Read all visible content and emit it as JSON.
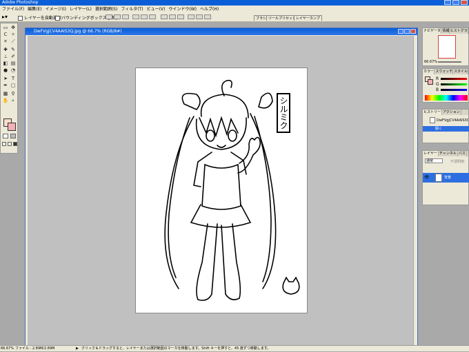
{
  "app": {
    "title": "Adobe Photoshop"
  },
  "menu": [
    "ファイル(F)",
    "編集(E)",
    "イメージ(I)",
    "レイヤー(L)",
    "選択範囲(S)",
    "フィルタ(T)",
    "ビュー(V)",
    "ウインドウ(W)",
    "ヘルプ(H)"
  ],
  "options": {
    "auto_select_label": "レイヤーを自動選択",
    "bounding_box_label": "バウンディングボックスを表示"
  },
  "workspace_tabs": [
    "ブラシ",
    "ツールプリセット",
    "レイヤーカンプ"
  ],
  "document": {
    "title": "DwFVgjCV4AAIS3Q.jpg @ 66.7% (RGB/8#)",
    "vertical_label": "シルミク"
  },
  "navigator": {
    "tabs": [
      "ナビゲーター",
      "情報",
      "ヒストグラム"
    ],
    "zoom": "66.67%"
  },
  "color_panel": {
    "tabs": [
      "カラー",
      "スウォッチ",
      "スタイル"
    ],
    "channels": [
      "R",
      "G",
      "B"
    ]
  },
  "history_panel": {
    "tabs": [
      "ヒストリー",
      "アクション"
    ],
    "items": [
      "DwFVgjCV4AAIS3Q.jpg",
      "開く"
    ]
  },
  "layers_panel": {
    "tabs": [
      "レイヤー",
      "チャンネル",
      "パス"
    ],
    "blend_mode": "通常",
    "opacity_label": "不透明度:",
    "layers": [
      "背景"
    ]
  },
  "status": {
    "zoom": "66.67%",
    "file_info": "ファイル : 2.89M/2.89M",
    "hint": "クリック＆ドラッグすると、レイヤーまたは選択範囲のマーカを移動します。Shift キーを押すと、45 度ずつ移動します。"
  },
  "colors": {
    "titlebar": "#0a5fd8",
    "foreground_swatch": "#f9dccb",
    "background_swatch": "#f2b1b6",
    "layer_selected": "#2d6fe0"
  }
}
